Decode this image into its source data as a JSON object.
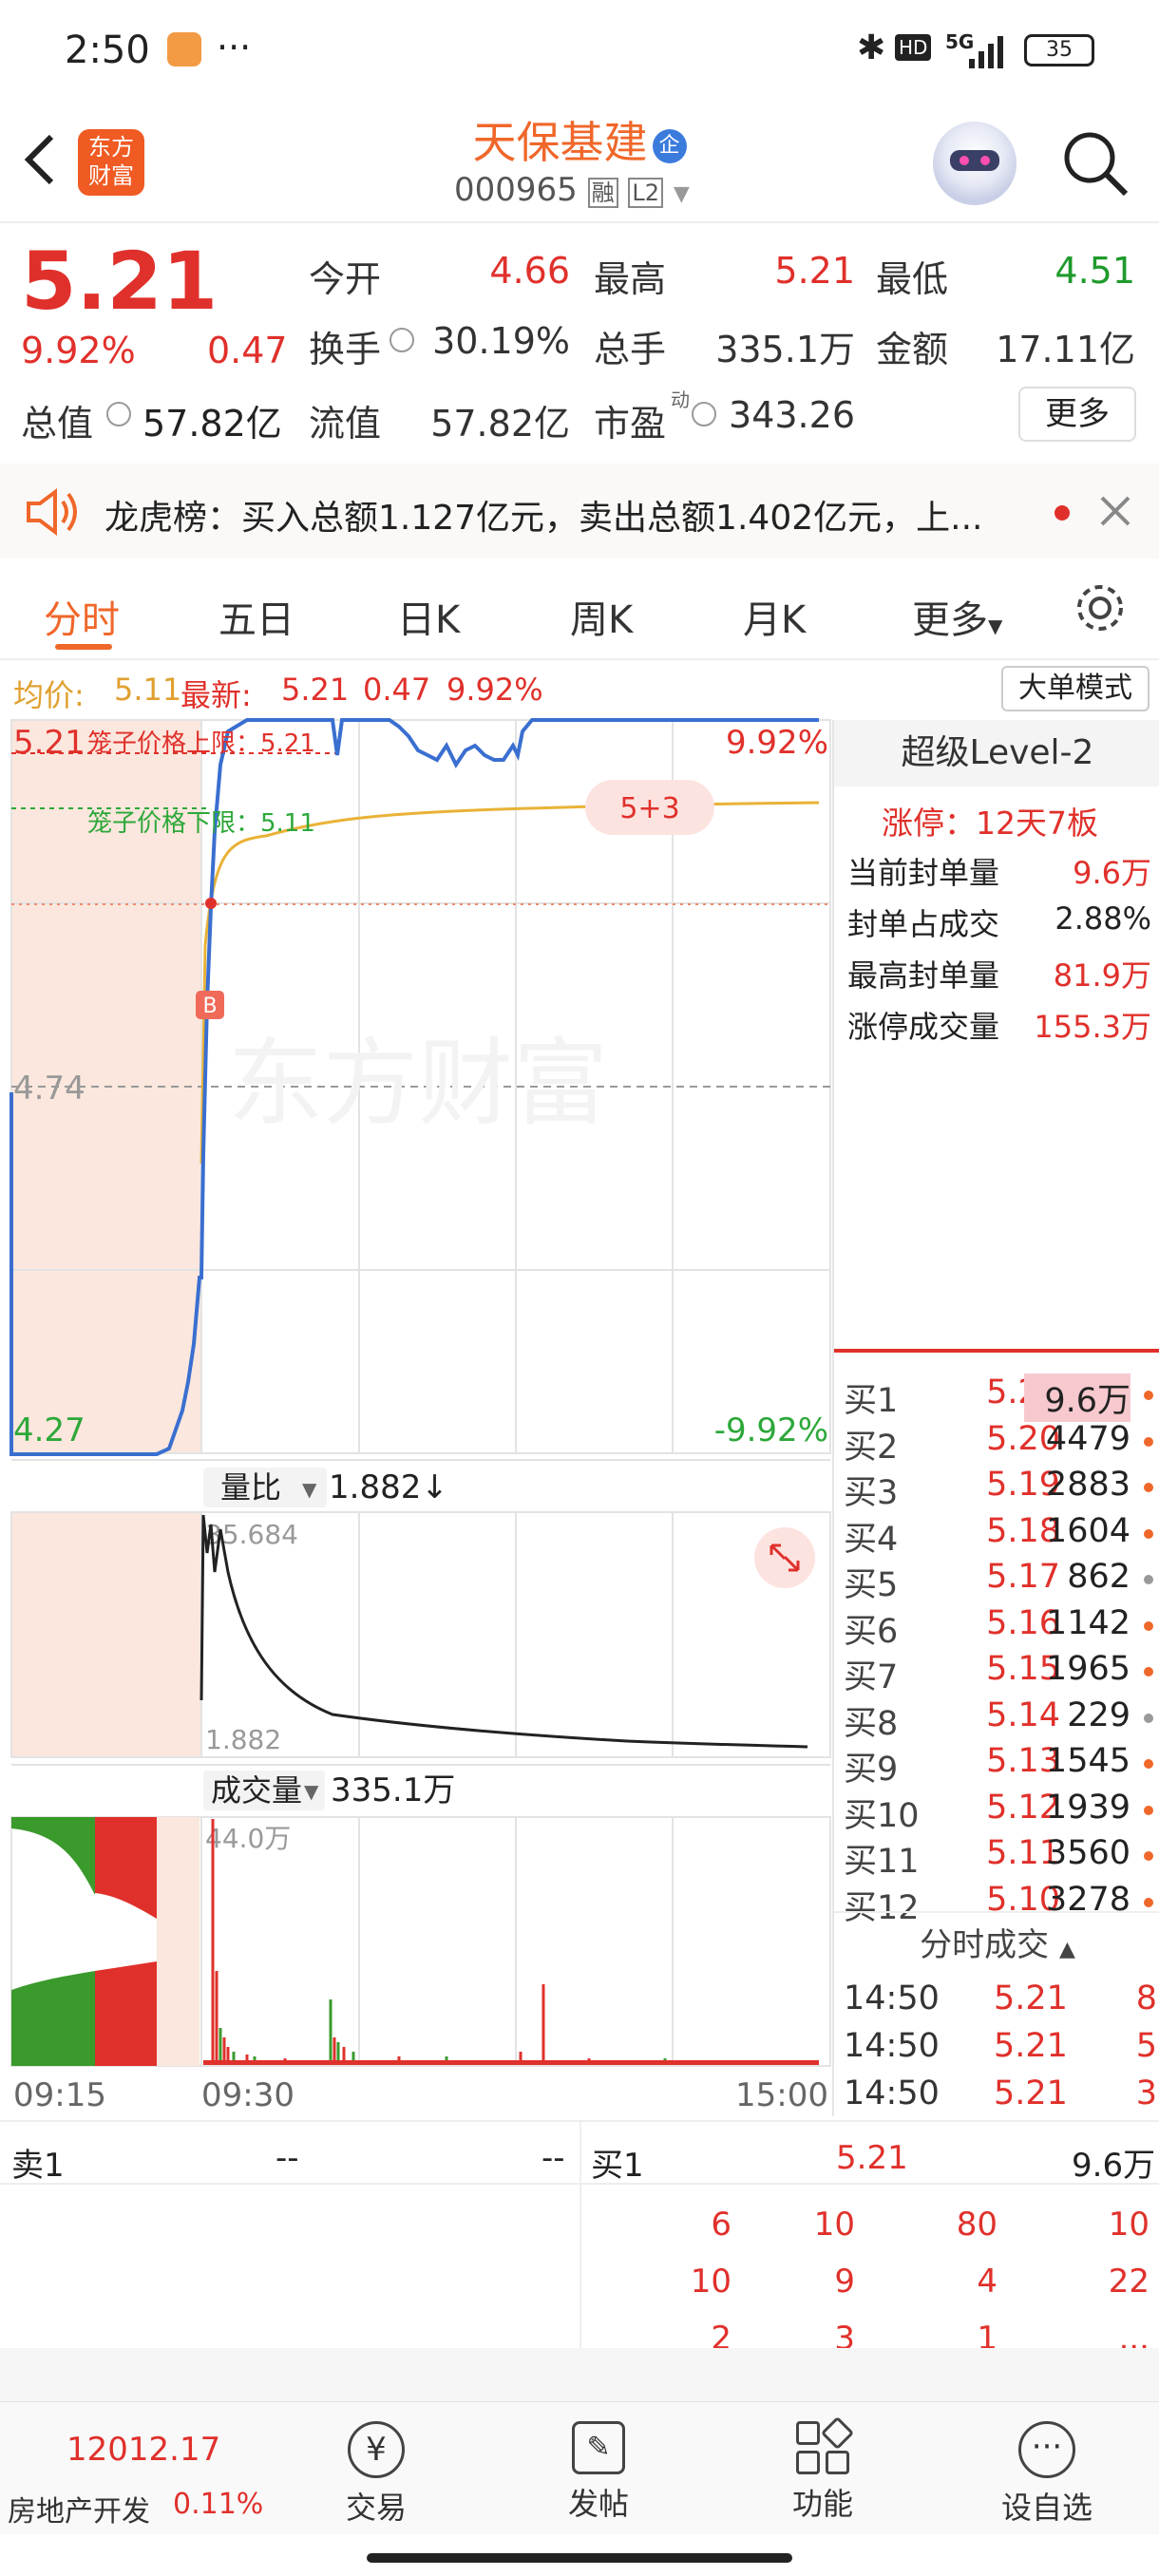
{
  "status": {
    "time": "2:50",
    "dots": "···",
    "signal": "5G",
    "battery": "35"
  },
  "header": {
    "title": "天保基建",
    "code": "000965",
    "rong": "融",
    "level": "L2",
    "logo": "东方\n财富"
  },
  "quote": {
    "price": "5.21",
    "pct": "9.92%",
    "change": "0.47",
    "jinkai_k": "今开",
    "jinkai_v": "4.66",
    "zuigao_k": "最高",
    "zuigao_v": "5.21",
    "zuidi_k": "最低",
    "zuidi_v": "4.51",
    "huanshou_k": "换手",
    "huanshou_v": "30.19%",
    "zongshou_k": "总手",
    "zongshou_v": "335.1万",
    "jine_k": "金额",
    "jine_v": "17.11亿",
    "zongzhi_k": "总值",
    "zongzhi_v": "57.82亿",
    "liuzhi_k": "流值",
    "liuzhi_v": "57.82亿",
    "shiying_k": "市盈",
    "shiying_sup": "动",
    "shiying_v": "343.26",
    "more": "更多"
  },
  "notice": {
    "text": "龙虎榜：买入总额1.127亿元，卖出总额1.402亿元，上..."
  },
  "tabs": [
    "分时",
    "五日",
    "日K",
    "周K",
    "月K",
    "更多"
  ],
  "chart": {
    "avg_label": "均价:",
    "avg": "5.11",
    "latest_label": "最新:",
    "latest": "5.21",
    "chg": "0.47",
    "pct": "9.92%",
    "mode_btn": "大单模式",
    "top_price": "5.21",
    "top_pct": "9.92%",
    "mid_price": "4.74",
    "bot_price": "4.27",
    "bot_pct": "-9.92%",
    "cage_up": "笼子价格上限：5.21",
    "cage_down": "笼子价格下限：5.11",
    "badge": "5+3",
    "b_marker": "B",
    "watermark": "东方财富",
    "lb_label": "量比",
    "lb_value": "1.882↓",
    "lb_max": "35.684",
    "lb_min": "1.882",
    "vol_label": "成交量",
    "vol_value": "335.1万",
    "vol_max": "44.0万",
    "t1": "09:15",
    "t2": "09:30",
    "t3": "15:00"
  },
  "chart_data": {
    "type": "line",
    "x": [
      "09:15",
      "09:30",
      "15:00"
    ],
    "ylim": [
      4.27,
      5.21
    ],
    "series": [
      {
        "values": [
          4.27,
          4.27,
          4.74,
          5.21,
          5.21
        ]
      },
      {
        "values": [
          4.3,
          4.74,
          5.09,
          5.11,
          5.11
        ]
      }
    ]
  },
  "level2": {
    "title": "超级Level-2",
    "zt": "涨停：12天7板",
    "rows": [
      {
        "k": "当前封单量",
        "v": "9.6万"
      },
      {
        "k": "封单占成交",
        "v": "2.88%"
      },
      {
        "k": "最高封单量",
        "v": "81.9万"
      },
      {
        "k": "涨停成交量",
        "v": "155.3万"
      }
    ],
    "book": [
      {
        "l": "买1",
        "p": "5.21",
        "v": "9.6万"
      },
      {
        "l": "买2",
        "p": "5.20",
        "v": "4479"
      },
      {
        "l": "买3",
        "p": "5.19",
        "v": "2883"
      },
      {
        "l": "买4",
        "p": "5.18",
        "v": "1604"
      },
      {
        "l": "买5",
        "p": "5.17",
        "v": "862"
      },
      {
        "l": "买6",
        "p": "5.16",
        "v": "1142"
      },
      {
        "l": "买7",
        "p": "5.15",
        "v": "1965"
      },
      {
        "l": "买8",
        "p": "5.14",
        "v": "229"
      },
      {
        "l": "买9",
        "p": "5.13",
        "v": "1545"
      },
      {
        "l": "买10",
        "p": "5.12",
        "v": "1939"
      },
      {
        "l": "买11",
        "p": "5.11",
        "v": "3560"
      },
      {
        "l": "买12",
        "p": "5.10",
        "v": "3278"
      }
    ],
    "ticks_title": "分时成交",
    "ticks": [
      {
        "t": "14:50",
        "p": "5.21",
        "v": "8"
      },
      {
        "t": "14:50",
        "p": "5.21",
        "v": "5"
      },
      {
        "t": "14:50",
        "p": "5.21",
        "v": "3"
      }
    ]
  },
  "bottom": {
    "sell_label": "卖1",
    "sell_p": "--",
    "sell_v": "--",
    "buy_label": "买1",
    "buy_p": "5.21",
    "buy_v": "9.6万",
    "grid": [
      [
        "6",
        "10",
        "80",
        "10"
      ],
      [
        "10",
        "9",
        "4",
        "22"
      ],
      [
        "2",
        "3",
        "1",
        "..."
      ]
    ]
  },
  "nav": {
    "index_value": "12012.17",
    "index_name": "房地产开发",
    "index_pct": "0.11%",
    "trade": "交易",
    "post": "发帖",
    "func": "功能",
    "watch": "设自选"
  }
}
